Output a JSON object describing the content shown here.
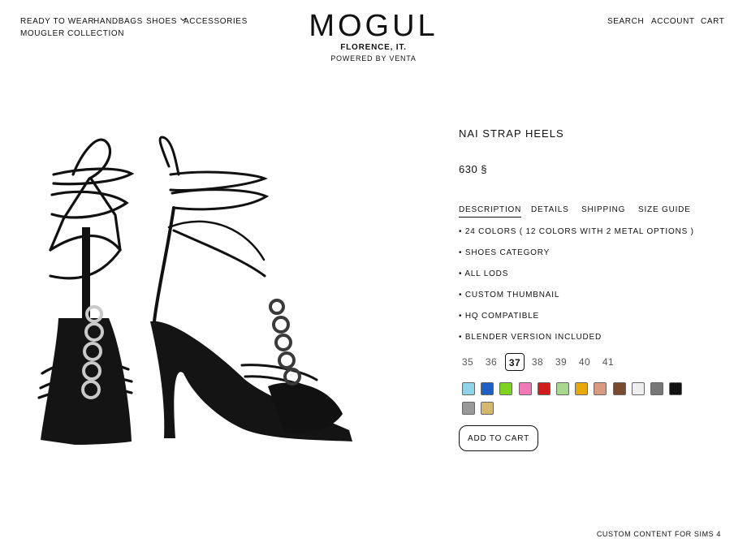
{
  "nav_left": {
    "ready_to_wear": "READY TO WEAR",
    "handbags": "HANDBAGS",
    "shoes": "SHOES",
    "accessories": "ACCESSORIES",
    "mougler": "MOUGLER COLLECTION"
  },
  "nav_right": {
    "search": "SEARCH",
    "account": "ACCOUNT",
    "cart": "CART"
  },
  "brand": {
    "logo": "MOGUL",
    "location": "FLORENCE, IT.",
    "powered": "POWERED BY VENTA"
  },
  "product": {
    "name": "NAI STRAP HEELS",
    "price": "630 §",
    "image_icon": "strappy-heels-image"
  },
  "tabs": [
    {
      "label": "DESCRIPTION",
      "active": true
    },
    {
      "label": "DETAILS",
      "active": false
    },
    {
      "label": "SHIPPING",
      "active": false
    },
    {
      "label": "SIZE GUIDE",
      "active": false
    }
  ],
  "description": [
    "• 24 COLORS ( 12 COLORS WITH 2 METAL OPTIONS )",
    "• SHOES CATEGORY",
    "• ALL LODS",
    "• CUSTOM THUMBNAIL",
    "• HQ COMPATIBLE",
    "• BLENDER VERSION INCLUDED"
  ],
  "sizes": {
    "options": [
      "35",
      "36",
      "37",
      "38",
      "39",
      "40",
      "41"
    ],
    "selected": "37"
  },
  "swatches": [
    "#8fd3e8",
    "#1f5fc4",
    "#7ed321",
    "#f07ab8",
    "#d01c1c",
    "#a8d890",
    "#e8a80c",
    "#d89a80",
    "#7a4a30",
    "#eeeeee",
    "#777777",
    "#111111",
    "#999999",
    "#d4b870"
  ],
  "add_to_cart": "ADD TO CART",
  "footer": "CUSTOM CONTENT FOR SIMS 4"
}
